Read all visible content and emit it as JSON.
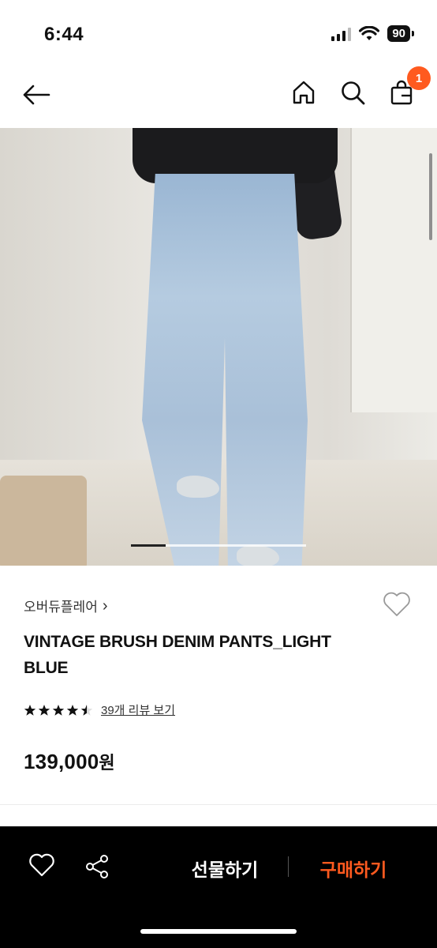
{
  "status_bar": {
    "time": "6:44",
    "battery_level": "90"
  },
  "nav": {
    "back_icon": "arrow-left-icon",
    "home_icon": "home-icon",
    "search_icon": "search-icon",
    "cart_icon": "shopping-bag-icon",
    "cart_count": "1",
    "badge_color": "#ff5a1f"
  },
  "carousel": {
    "progress": 0.2
  },
  "product": {
    "brand": "오버듀플레어",
    "brand_chevron": "›",
    "title": "VINTAGE BRUSH DENIM PANTS_LIGHT BLUE",
    "rating": 4.5,
    "review_link": "39개 리뷰 보기",
    "price": "139,000",
    "price_unit": "원"
  },
  "bottom_bar": {
    "wishlist_icon": "heart-outline-icon",
    "share_icon": "share-icon",
    "gift_label": "선물하기",
    "buy_label": "구매하기",
    "buy_color": "#ff5a1f"
  }
}
